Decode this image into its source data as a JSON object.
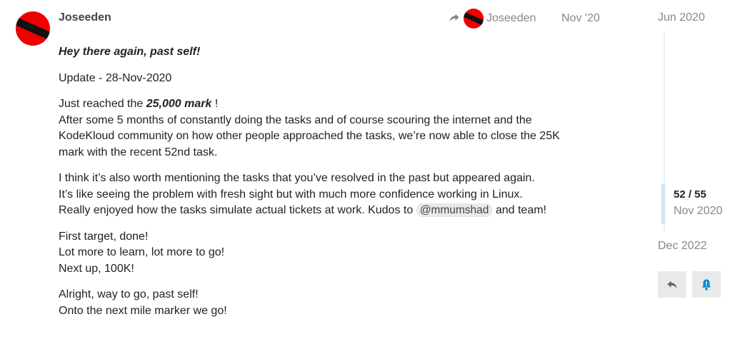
{
  "post": {
    "username": "Joseeden",
    "reply_to_username": "Joseeden",
    "date": "Nov '20",
    "greeting": "Hey there again, past self!",
    "update_line": "Update - 28-Nov-2020",
    "para1_prefix": "Just reached the ",
    "para1_bold": "25,000 mark",
    "para1_suffix": " !",
    "para1_line2": "After some 5 months of constantly doing the tasks and of course scouring the internet and the KodeKloud community on how other people approached the tasks, we’re now able to close the 25K mark with the recent 52nd task.",
    "para2_line1": "I think it’s also worth mentioning the tasks that you’ve resolved in the past but appeared again.",
    "para2_line2": "It’s like seeing the problem with fresh sight but with much more confidence working in Linux.",
    "para2_line3_prefix": "Really enjoyed how the tasks simulate actual tickets at work. Kudos to ",
    "mention": "@mmumshad",
    "para2_line3_suffix": " and team!",
    "para3_line1": "First target, done!",
    "para3_line2": "Lot more to learn, lot more to go!",
    "para3_line3": "Next up, 100K!",
    "para4_line1": "Alright, way to go, past self!",
    "para4_line2": "Onto the next mile marker we go!"
  },
  "timeline": {
    "start": "Jun 2020",
    "position": "52 / 55",
    "position_date": "Nov 2020",
    "end": "Dec 2022"
  },
  "colors": {
    "avatar_red": "#ee0000",
    "accent_blue": "#0088cc",
    "muted": "#888888"
  },
  "icons": {
    "reply_to": "share-arrow-icon",
    "reply": "reply-icon",
    "notify": "bell-alert-icon"
  }
}
